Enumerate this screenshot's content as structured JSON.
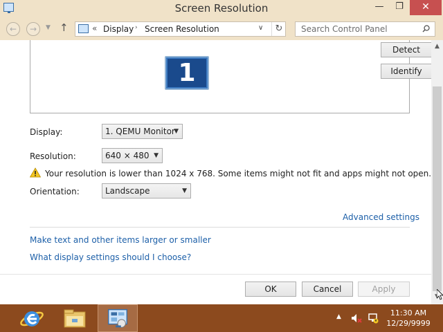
{
  "window": {
    "title": "Screen Resolution",
    "minimize_glyph": "—",
    "maximize_glyph": "❐",
    "close_glyph": "✕"
  },
  "address_bar": {
    "chevron": "«",
    "crumbs": [
      "Display",
      "Screen Resolution"
    ],
    "separator": "›"
  },
  "search": {
    "placeholder": "Search Control Panel"
  },
  "monitor": {
    "number": "1"
  },
  "buttons": {
    "detect": "Detect",
    "identify": "Identify",
    "ok": "OK",
    "cancel": "Cancel",
    "apply": "Apply"
  },
  "fields": {
    "display_label": "Display:",
    "display_value": "1. QEMU Monitor",
    "resolution_label": "Resolution:",
    "resolution_value": "640 × 480",
    "orientation_label": "Orientation:",
    "orientation_value": "Landscape"
  },
  "warning": "Your resolution is lower than 1024 x 768. Some items might not fit and apps might not open.",
  "links": {
    "advanced": "Advanced settings",
    "larger": "Make text and other items larger or smaller",
    "which": "What display settings should I choose?"
  },
  "taskbar": {
    "time": "11:30 AM",
    "date": "12/29/9999"
  },
  "colors": {
    "title_bar": "#f0e2c8",
    "close_button": "#c75050",
    "link": "#1c5fa8",
    "taskbar": "#8c4a1e"
  },
  "icons": {
    "app": "control-panel-icon",
    "back": "back-arrow-icon",
    "forward": "forward-arrow-icon",
    "up": "up-arrow-icon",
    "refresh": "refresh-icon",
    "search": "search-icon",
    "warning": "warning-icon",
    "ie": "internet-explorer-icon",
    "explorer": "file-explorer-icon",
    "volume": "volume-muted-icon",
    "network": "network-icon"
  }
}
